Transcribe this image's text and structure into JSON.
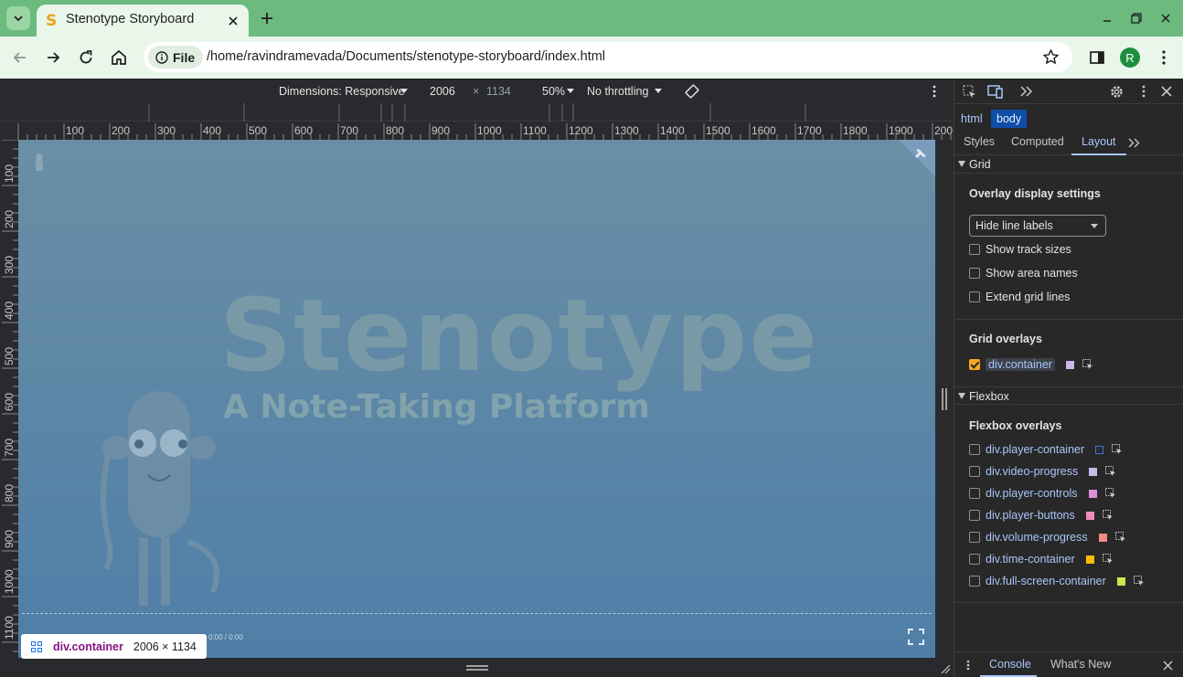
{
  "browser": {
    "tab_title": "Stenotype Storyboard",
    "favicon_letter": "S",
    "omnibox_chip": "File",
    "url": "/home/ravindramevada/Documents/stenotype-storyboard/index.html",
    "avatar_letter": "R"
  },
  "device_toolbar": {
    "dimensions": "Dimensions: Responsive",
    "width": "2006",
    "times": "×",
    "height": "1134",
    "zoom": "50%",
    "throttling": "No throttling"
  },
  "rulers": {
    "top": [
      "100",
      "200",
      "300",
      "400",
      "500",
      "600",
      "700",
      "800",
      "900",
      "1000",
      "1100",
      "1200",
      "1300",
      "1400",
      "1500",
      "1600",
      "1700",
      "1800",
      "1900",
      "200"
    ],
    "left": [
      "100",
      "200",
      "300",
      "400",
      "500",
      "600",
      "700",
      "800",
      "900",
      "1000",
      "1100"
    ]
  },
  "page": {
    "hero_title": "Stenotype",
    "hero_subtitle": "A Note-Taking Platform",
    "time": "0:00 / 0:00"
  },
  "inspect_tooltip": {
    "element": "div.container",
    "size": "2006 × 1134"
  },
  "devtools": {
    "breadcrumbs": [
      "html",
      "body"
    ],
    "subtabs": [
      "Styles",
      "Computed",
      "Layout"
    ],
    "grid": {
      "header": "Grid",
      "overlay_settings_title": "Overlay display settings",
      "select_value": "Hide line labels",
      "options": [
        "Show track sizes",
        "Show area names",
        "Extend grid lines"
      ],
      "overlays_title": "Grid overlays",
      "overlays": [
        {
          "name": "div.container",
          "color": "#c7b8e8",
          "checked": true
        }
      ]
    },
    "flexbox": {
      "header": "Flexbox",
      "overlays_title": "Flexbox overlays",
      "overlays": [
        {
          "name": "div.player-container",
          "color": "#1a237e",
          "checked": false
        },
        {
          "name": "div.video-progress",
          "color": "#c9b8ea",
          "checked": false
        },
        {
          "name": "div.player-controls",
          "color": "#dd8fd8",
          "checked": false
        },
        {
          "name": "div.player-buttons",
          "color": "#f28bb6",
          "checked": false
        },
        {
          "name": "div.volume-progress",
          "color": "#f28b82",
          "checked": false
        },
        {
          "name": "div.time-container",
          "color": "#fbbc04",
          "checked": false
        },
        {
          "name": "div.full-screen-container",
          "color": "#d2e34b",
          "checked": false
        }
      ]
    },
    "drawer_tabs": [
      "Console",
      "What's New"
    ]
  }
}
